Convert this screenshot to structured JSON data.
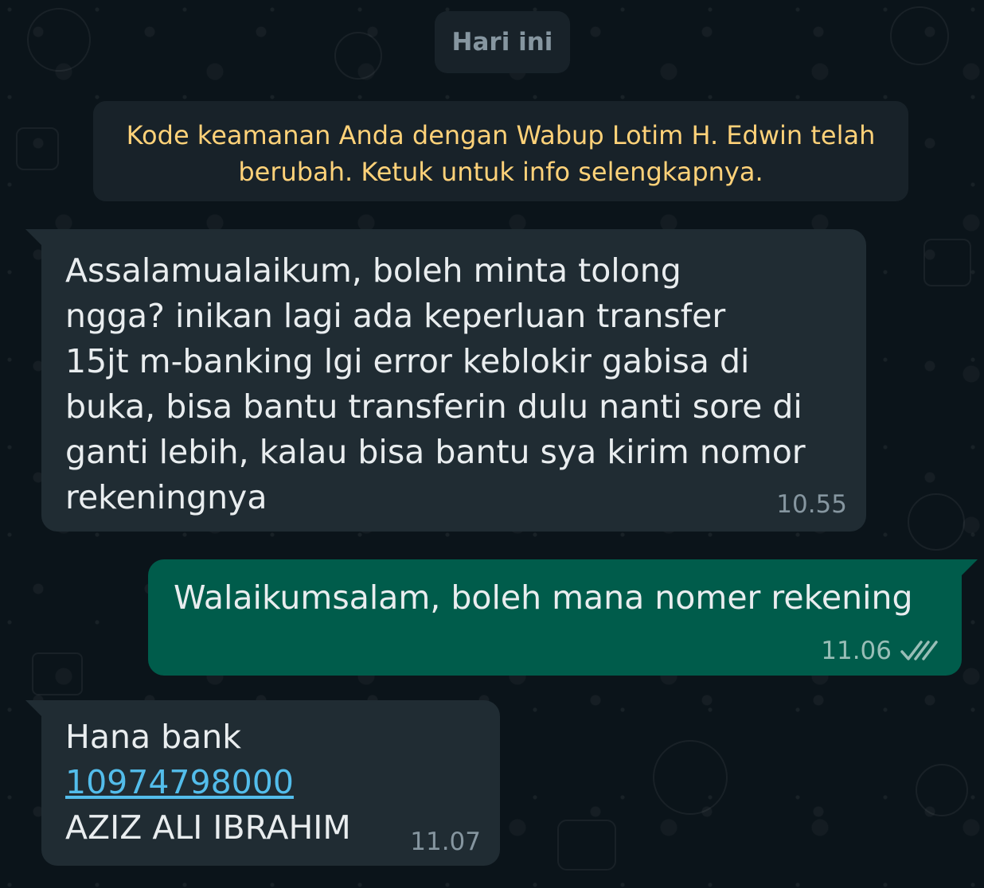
{
  "date_chip": "Hari ini",
  "system_notice": "Kode keamanan Anda dengan Wabup Lotim H. Edwin telah berubah. Ketuk untuk info selengkapnya.",
  "messages": [
    {
      "direction": "incoming",
      "text": "Assalamualaikum, boleh minta tolong\nngga? inikan lagi ada keperluan transfer\n15jt m-banking lgi error keblokir gabisa di\nbuka, bisa bantu transferin dulu nanti sore di\nganti lebih, kalau bisa bantu sya kirim nomor\nrekeningnya",
      "time": "10.55"
    },
    {
      "direction": "outgoing",
      "text": "Walaikumsalam, boleh mana nomer rekening",
      "time": "11.06",
      "status": "read"
    },
    {
      "direction": "incoming",
      "bank": "Hana bank",
      "account_number": "10974798000",
      "account_name": "AZIZ ALI IBRAHIM",
      "time": "11.07"
    }
  ],
  "colors": {
    "background": "#0b141a",
    "incoming_bubble": "#202c33",
    "outgoing_bubble": "#005c4b",
    "system_text": "#ffd279",
    "link": "#53bdeb",
    "read_ticks": "#99beb7"
  }
}
